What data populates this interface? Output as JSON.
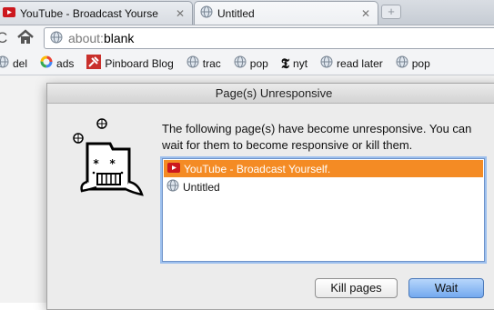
{
  "tabs": [
    {
      "title": "YouTube - Broadcast Yourse",
      "close": "✕",
      "icon": "youtube-icon"
    },
    {
      "title": "Untitled",
      "close": "✕",
      "icon": "globe-icon"
    }
  ],
  "toolbar": {
    "reload_glyph": "C",
    "omnibox": {
      "scheme": "about:",
      "rest": "blank"
    }
  },
  "bookmarks": [
    {
      "label": "del",
      "icon": "globe-icon"
    },
    {
      "label": "ads",
      "icon": "google-icon"
    },
    {
      "label": "Pinboard Blog",
      "icon": "pinboard-icon"
    },
    {
      "label": "trac",
      "icon": "globe-icon"
    },
    {
      "label": "pop",
      "icon": "globe-icon"
    },
    {
      "label": "nyt",
      "icon": "nyt-icon"
    },
    {
      "label": "read later",
      "icon": "globe-icon"
    },
    {
      "label": "pop",
      "icon": "globe-icon"
    }
  ],
  "dialog": {
    "title": "Page(s) Unresponsive",
    "message": "The following page(s) have become unresponsive. You can wait for them to become responsive or kill them.",
    "pages": [
      {
        "label": "YouTube - Broadcast Yourself.",
        "icon": "youtube-icon",
        "selected": true
      },
      {
        "label": "Untitled",
        "icon": "globe-icon",
        "selected": false
      }
    ],
    "kill_button": "Kill pages",
    "wait_button": "Wait"
  },
  "colors": {
    "selection": "#f48b24",
    "wait_button": "#73a9ef",
    "youtube_red": "#cc181e"
  }
}
